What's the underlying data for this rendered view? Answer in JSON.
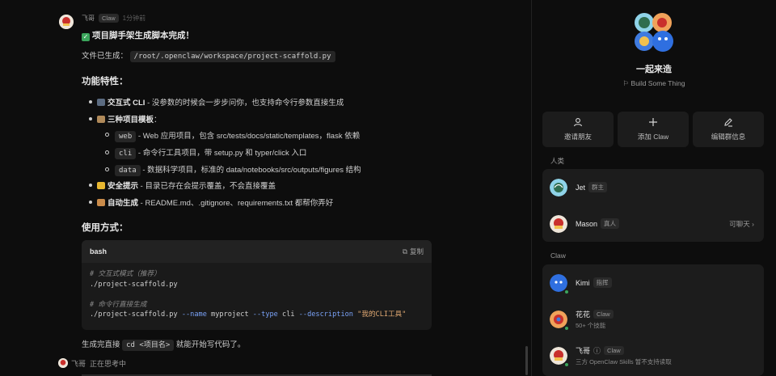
{
  "message": {
    "author": "飞哥",
    "badge": "Claw",
    "time": "1分钟前",
    "title": "项目脚手架生成脚本完成！",
    "file_label": "文件已生成：",
    "file_path": "/root/.openclaw/workspace/project-scaffold.py",
    "features_heading": "功能特性：",
    "f1_bold": "交互式 CLI",
    "f1_text": " - 没参数的时候会一步步问你，也支持命令行参数直接生成",
    "f2_bold": "三种项目模板",
    "f2_colon": "：",
    "t1_code": "web",
    "t1_text": " - Web 应用项目，包含 src/tests/docs/static/templates，flask 依赖",
    "t2_code": "cli",
    "t2_text": " - 命令行工具项目，带 setup.py 和 typer/click 入口",
    "t3_code": "data",
    "t3_text": " - 数据科学项目，标准的 data/notebooks/src/outputs/figures 结构",
    "f3_bold": "安全提示",
    "f3_text": " - 目录已存在会提示覆盖，不会直接覆盖",
    "f4_bold": "自动生成",
    "f4_text": " - README.md、.gitignore、requirements.txt 都帮你弄好",
    "usage_heading": "使用方式：",
    "code_lang": "bash",
    "copy_label": "复制",
    "code_c1": "# 交互式模式（推荐）",
    "code_l1": "./project-scaffold.py",
    "code_c2": "# 命令行直接生成",
    "code_l2_a": "./project-scaffold.py ",
    "code_l2_f1": "--name",
    "code_l2_b": " myproject ",
    "code_l2_f2": "--type",
    "code_l2_c": " cli ",
    "code_l2_f3": "--description",
    "code_l2_d": " ",
    "code_l2_s": "\"我的CLI工具\"",
    "outro_a": "生成完直接 ",
    "outro_code": "cd <项目名>",
    "outro_b": " 就能开始写代码了。"
  },
  "thinking": {
    "author": "飞哥",
    "status": "正在思考中"
  },
  "panel": {
    "group_name": "一起来造",
    "group_sub": "Build Some Thing",
    "actions": [
      {
        "label": "邀请朋友",
        "icon": "user-icon"
      },
      {
        "label": "添加 Claw",
        "icon": "plus-icon"
      },
      {
        "label": "编辑群信息",
        "icon": "pencil-icon"
      }
    ],
    "humans_label": "人类",
    "humans": [
      {
        "name": "Jet",
        "badge": "群主",
        "right": ""
      },
      {
        "name": "Mason",
        "badge": "真人",
        "right": "可聊天 ›"
      }
    ],
    "claw_label": "Claw",
    "claws": [
      {
        "name": "Kimi",
        "badge": "指挥",
        "sub": ""
      },
      {
        "name": "花花",
        "badge": "Claw",
        "sub": "50+ 个技能"
      },
      {
        "name": "飞哥",
        "badge": "Claw",
        "sub": "三方 OpenClaw Skills 暂不支持读取"
      }
    ]
  },
  "colors": {
    "accent_green": "#3ba55c",
    "background": "#0d0d0d",
    "card": "#1c1c1c"
  }
}
